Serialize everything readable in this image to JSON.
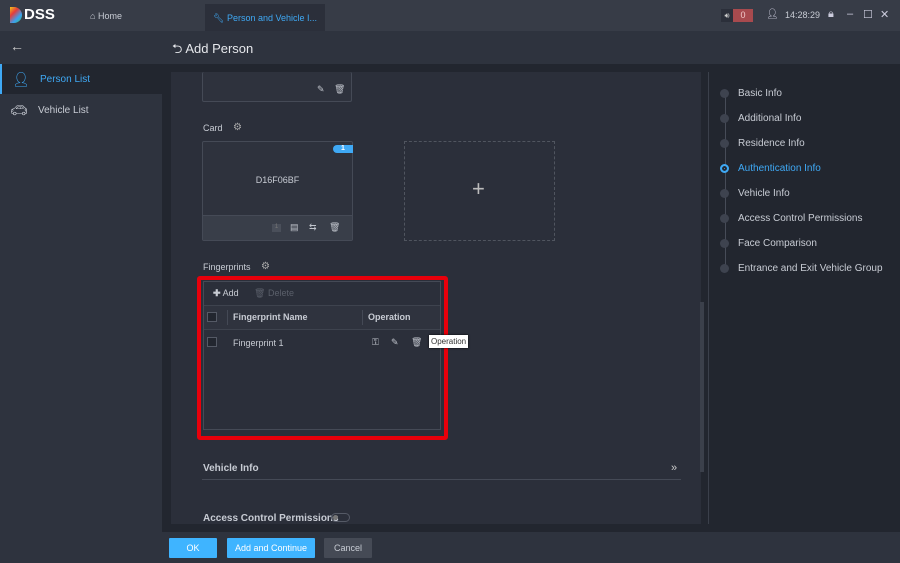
{
  "topbar": {
    "logo": "DSS",
    "home_tab": "Home",
    "active_tab": "Person and Vehicle I...",
    "alarm_count": "0",
    "time": "14:28:29"
  },
  "sidebar": {
    "items": [
      {
        "label": "Person List",
        "active": true
      },
      {
        "label": "Vehicle List",
        "active": false
      }
    ]
  },
  "header": {
    "title": "Add Person"
  },
  "card_section": {
    "label": "Card",
    "card_number": "D16F06BF",
    "badge": "1",
    "slot_number": "1"
  },
  "fingerprints": {
    "label": "Fingerprints",
    "add_label": "Add",
    "delete_label": "Delete",
    "columns": [
      "Fingerprint Name",
      "Operation"
    ],
    "rows": [
      {
        "name": "Fingerprint 1"
      }
    ],
    "tooltip": "Operation"
  },
  "vehicle_info": {
    "label": "Vehicle Info"
  },
  "access_control": {
    "label": "Access Control Permissions",
    "enabled": false
  },
  "right_nav": {
    "items": [
      {
        "label": "Basic Info"
      },
      {
        "label": "Additional Info"
      },
      {
        "label": "Residence Info"
      },
      {
        "label": "Authentication Info",
        "active": true
      },
      {
        "label": "Vehicle Info"
      },
      {
        "label": "Access Control Permissions"
      },
      {
        "label": "Face Comparison"
      },
      {
        "label": "Entrance and Exit Vehicle Group"
      }
    ]
  },
  "footer": {
    "ok": "OK",
    "add_continue": "Add and Continue",
    "cancel": "Cancel"
  },
  "colors": {
    "accent": "#3fa9f5",
    "highlight": "#e8000b",
    "alarm": "#a84a4e"
  }
}
